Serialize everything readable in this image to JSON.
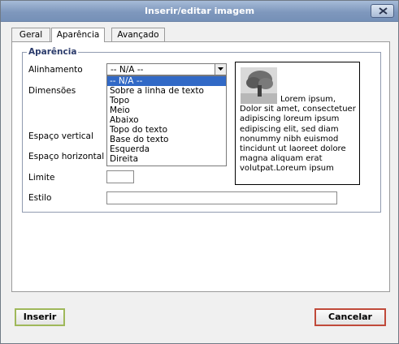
{
  "window": {
    "title": "Inserir/editar imagem"
  },
  "tabs": [
    {
      "label": "Geral"
    },
    {
      "label": "Aparência"
    },
    {
      "label": "Avançado"
    }
  ],
  "appearance": {
    "legend": "Aparência",
    "alignment_label": "Alinhamento",
    "alignment_value": "-- N/A --",
    "alignment_options": [
      "-- N/A --",
      "Sobre a linha de texto",
      "Topo",
      "Meio",
      "Abaixo",
      "Topo do texto",
      "Base do texto",
      "Esquerda",
      "Direita"
    ],
    "dimensions_label": "Dimensões",
    "vspace_label": "Espaço vertical",
    "hspace_label": "Espaço horizontal",
    "border_label": "Limite",
    "style_label": "Estilo",
    "border_value": "",
    "style_value": "",
    "preview_text": "Lorem ipsum, Dolor sit amet, consectetuer adipiscing loreum ipsum edipiscing elit, sed diam nonummy nibh euismod tincidunt ut laoreet dolore magna aliquam erat volutpat.Loreum ipsum"
  },
  "buttons": {
    "insert": "Inserir",
    "cancel": "Cancelar"
  },
  "icons": {
    "close": "close-icon",
    "dropdown": "chevron-down-icon",
    "preview": "tree-image-icon"
  }
}
